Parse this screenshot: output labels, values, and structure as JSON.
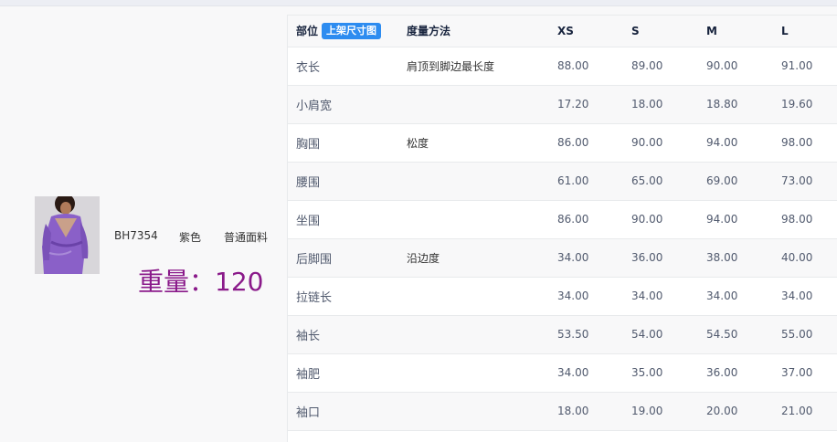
{
  "product": {
    "code": "BH7354",
    "color": "紫色",
    "fabric": "普通面料",
    "weight_text": "重量：120"
  },
  "table": {
    "headers": {
      "part": "部位",
      "tag": "上架尺寸图",
      "method": "度量方法",
      "xs": "XS",
      "s": "S",
      "m": "M",
      "l": "L"
    },
    "rows": [
      {
        "part": "衣长",
        "method": "肩顶到脚边最长度",
        "xs": "88.00",
        "s": "89.00",
        "m": "90.00",
        "l": "91.00"
      },
      {
        "part": "小肩宽",
        "method": "",
        "xs": "17.20",
        "s": "18.00",
        "m": "18.80",
        "l": "19.60"
      },
      {
        "part": "胸围",
        "method": "松度",
        "xs": "86.00",
        "s": "90.00",
        "m": "94.00",
        "l": "98.00"
      },
      {
        "part": "腰围",
        "method": "",
        "xs": "61.00",
        "s": "65.00",
        "m": "69.00",
        "l": "73.00"
      },
      {
        "part": "坐围",
        "method": "",
        "xs": "86.00",
        "s": "90.00",
        "m": "94.00",
        "l": "98.00"
      },
      {
        "part": "后脚围",
        "method": "沿边度",
        "xs": "34.00",
        "s": "36.00",
        "m": "38.00",
        "l": "40.00"
      },
      {
        "part": "拉链长",
        "method": "",
        "xs": "34.00",
        "s": "34.00",
        "m": "34.00",
        "l": "34.00"
      },
      {
        "part": "袖长",
        "method": "",
        "xs": "53.50",
        "s": "54.00",
        "m": "54.50",
        "l": "55.00"
      },
      {
        "part": "袖肥",
        "method": "",
        "xs": "34.00",
        "s": "35.00",
        "m": "36.00",
        "l": "37.00"
      },
      {
        "part": "袖口",
        "method": "",
        "xs": "18.00",
        "s": "19.00",
        "m": "20.00",
        "l": "21.00"
      }
    ]
  },
  "colors": {
    "accent": "#2d8cf0",
    "weight": "#8a1a8a"
  }
}
